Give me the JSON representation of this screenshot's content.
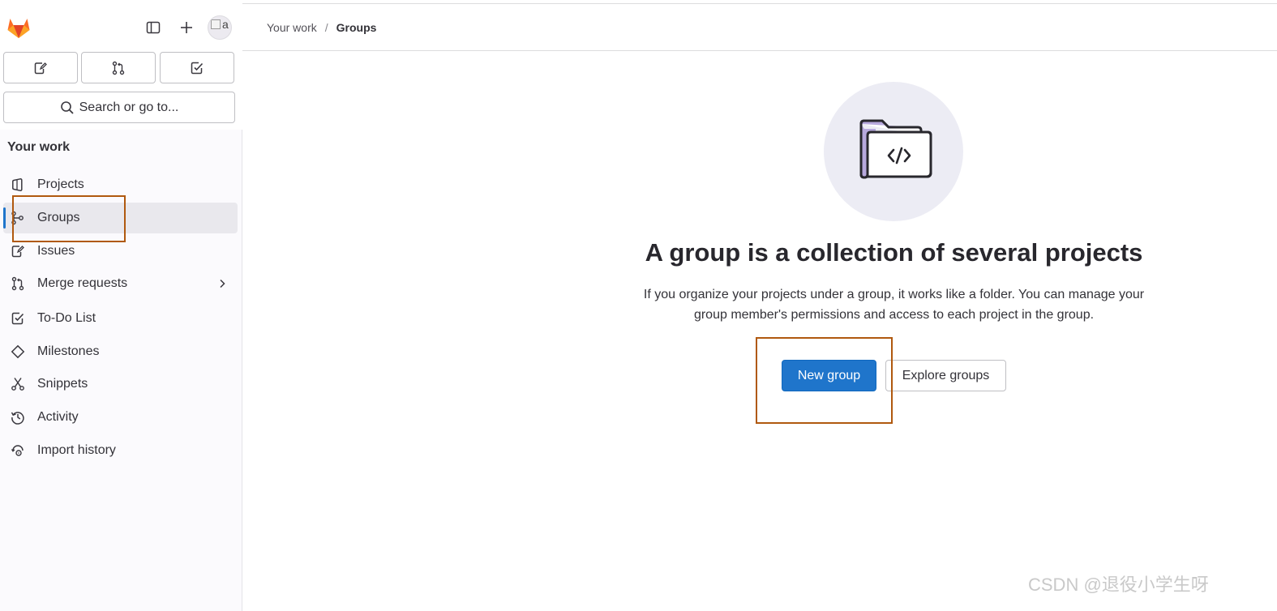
{
  "sidebar": {
    "quick_actions": [
      {
        "name": "issues-icon"
      },
      {
        "name": "merge-request-icon"
      },
      {
        "name": "todo-icon"
      }
    ],
    "search_label": "Search or go to...",
    "section_title": "Your work",
    "items": [
      {
        "label": "Projects",
        "icon": "project-icon",
        "active": false
      },
      {
        "label": "Groups",
        "icon": "group-icon",
        "active": true
      },
      {
        "label": "Issues",
        "icon": "issues-icon",
        "active": false
      },
      {
        "label": "Merge requests",
        "icon": "merge-request-icon",
        "active": false,
        "has_submenu": true
      },
      {
        "label": "To-Do List",
        "icon": "todo-icon",
        "active": false
      },
      {
        "label": "Milestones",
        "icon": "milestone-icon",
        "active": false
      },
      {
        "label": "Snippets",
        "icon": "snippet-icon",
        "active": false
      },
      {
        "label": "Activity",
        "icon": "history-icon",
        "active": false
      },
      {
        "label": "Import history",
        "icon": "import-icon",
        "active": false
      }
    ],
    "avatar_alt": "a"
  },
  "breadcrumb": {
    "parent": "Your work",
    "separator": "/",
    "current": "Groups"
  },
  "empty_state": {
    "title": "A group is a collection of several projects",
    "description": "If you organize your projects under a group, it works like a folder. You can manage your group member's permissions and access to each project in the group.",
    "primary_button": "New group",
    "secondary_button": "Explore groups"
  },
  "watermark": "CSDN @退役小学生呀",
  "colors": {
    "accent": "#1f75cb",
    "annotation": "#b0590f",
    "illustration_bg": "#ececf4"
  }
}
